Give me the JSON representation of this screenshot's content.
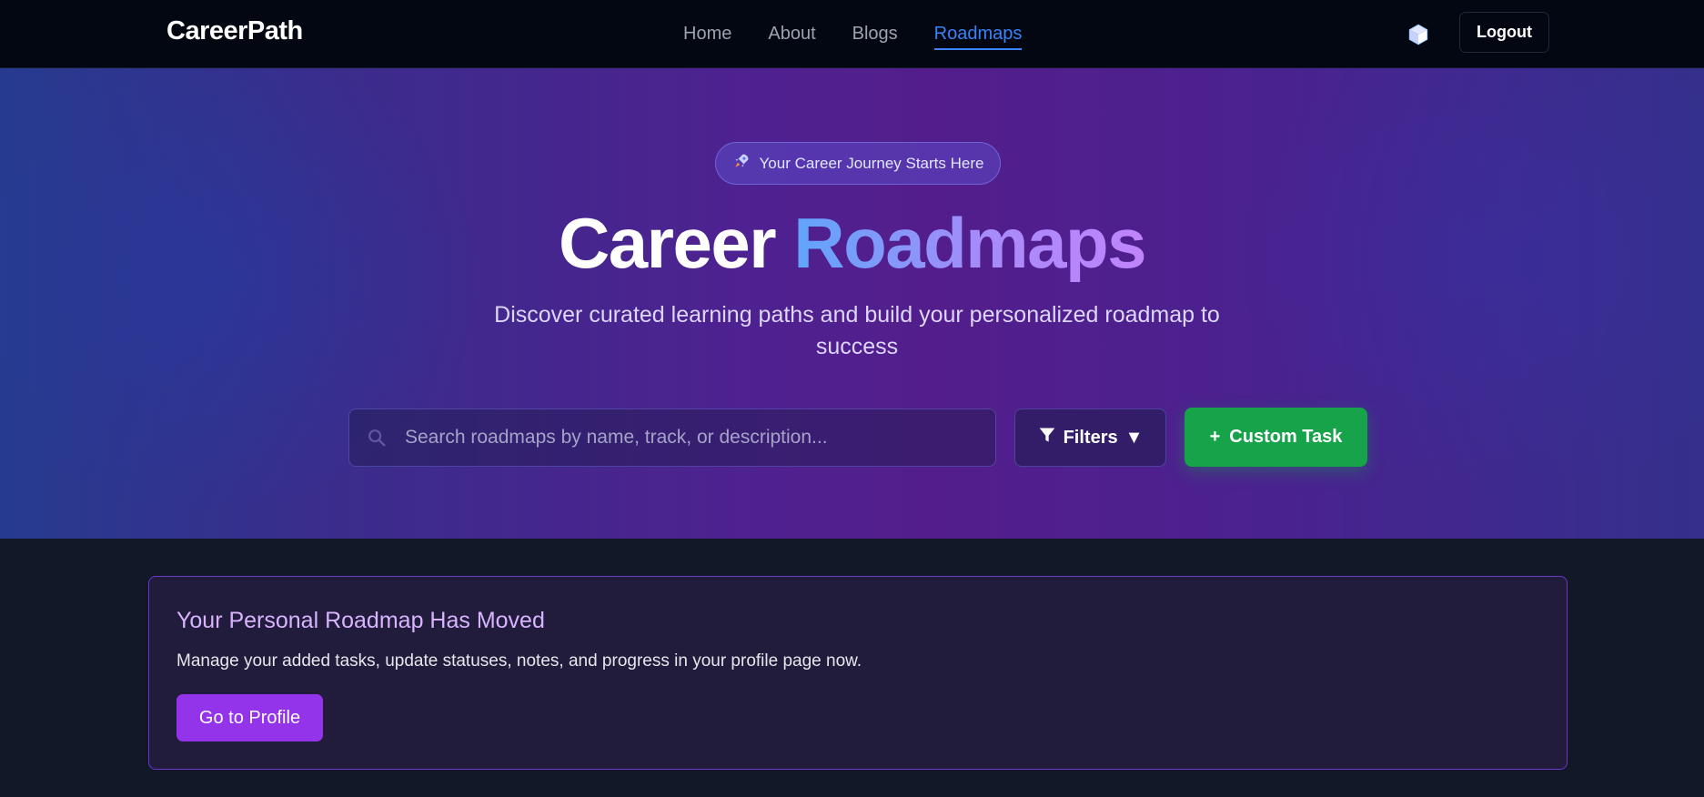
{
  "nav": {
    "brand": "CareerPath",
    "links": [
      {
        "label": "Home",
        "active": false
      },
      {
        "label": "About",
        "active": false
      },
      {
        "label": "Blogs",
        "active": false
      },
      {
        "label": "Roadmaps",
        "active": true
      }
    ],
    "theme_icon": "cube-icon",
    "logout_label": "Logout"
  },
  "hero": {
    "badge_icon": "rocket-icon",
    "badge_text": "Your Career Journey Starts Here",
    "title_plain": "Career",
    "title_accent": "Roadmaps",
    "subtitle": "Discover curated learning paths and build your personalized roadmap to success",
    "search": {
      "icon": "search-icon",
      "placeholder": "Search roadmaps by name, track, or description...",
      "value": ""
    },
    "filters_label": "Filters",
    "filters_caret": "▼",
    "custom_task_prefix": "+",
    "custom_task_label": "Custom Task"
  },
  "notice": {
    "title": "Your Personal Roadmap Has Moved",
    "text": "Manage your added tasks, update statuses, notes, and progress in your profile page now.",
    "button_label": "Go to Profile"
  },
  "colors": {
    "nav_bg": "#030712",
    "page_bg": "#111827",
    "active_link": "#3b82f6",
    "accent_green": "#16a34a",
    "accent_purple": "#9333ea",
    "notice_title": "#d8b4fe"
  }
}
